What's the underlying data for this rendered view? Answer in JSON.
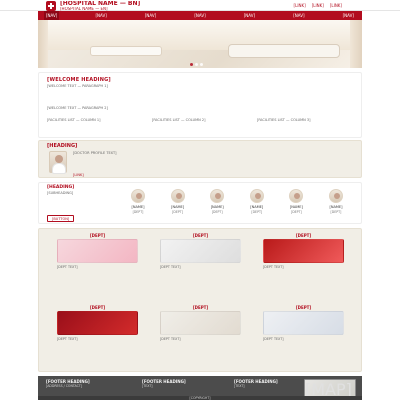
{
  "header": {
    "brand_bn": "[HOSPITAL NAME — BN]",
    "brand_en": "[HOSPITAL NAME — EN]",
    "top_links": [
      "[LINK]",
      "[LINK]",
      "[LINK]"
    ],
    "brand_color": "#b20d1f",
    "logo_icon": "hospital-cross-icon"
  },
  "nav": {
    "items": [
      "[NAV]",
      "[NAV]",
      "[NAV]",
      "[NAV]",
      "[NAV]",
      "[NAV]",
      "[NAV]"
    ],
    "active_index": 0
  },
  "hero": {
    "active_slide": 0,
    "slides": 3
  },
  "welcome": {
    "title": "[WELCOME HEADING]",
    "paragraph_1": "[WELCOME TEXT — PARAGRAPH 1]",
    "paragraph_2": "[WELCOME TEXT — PARAGRAPH 2]",
    "facilities": [
      "[FACILITIES LIST — COLUMN 1]",
      "[FACILITIES LIST — COLUMN 2]",
      "[FACILITIES LIST — COLUMN 3]"
    ]
  },
  "doctor_highlight": {
    "heading": "[HEADING]",
    "text": "[DOCTOR PROFILE TEXT]",
    "link": "[LINK]"
  },
  "specialists": {
    "heading": "[HEADING]",
    "subheading": "[SUBHEADING]",
    "button": "[BUTTON]",
    "doctors": [
      {
        "name": "[NAME]",
        "dept": "[DEPT]"
      },
      {
        "name": "[NAME]",
        "dept": "[DEPT]"
      },
      {
        "name": "[NAME]",
        "dept": "[DEPT]"
      },
      {
        "name": "[NAME]",
        "dept": "[DEPT]"
      },
      {
        "name": "[NAME]",
        "dept": "[DEPT]"
      },
      {
        "name": "[NAME]",
        "dept": "[DEPT]"
      }
    ]
  },
  "departments": [
    {
      "title": "[DEPT]",
      "text": "[DEPT TEXT]"
    },
    {
      "title": "[DEPT]",
      "text": "[DEPT TEXT]"
    },
    {
      "title": "[DEPT]",
      "text": "[DEPT TEXT]"
    },
    {
      "title": "[DEPT]",
      "text": "[DEPT TEXT]"
    },
    {
      "title": "[DEPT]",
      "text": "[DEPT TEXT]"
    },
    {
      "title": "[DEPT]",
      "text": "[DEPT TEXT]"
    }
  ],
  "footer": {
    "col1_heading": "[FOOTER HEADING]",
    "col1_text": "[ADDRESS / CONTACT]",
    "col2_heading": "[FOOTER HEADING]",
    "col2_text": "[TEXT]",
    "col3_heading": "[FOOTER HEADING]",
    "col3_text": "[TEXT]",
    "map_label": "[MAP]",
    "copyright": "[COPYRIGHT]"
  }
}
